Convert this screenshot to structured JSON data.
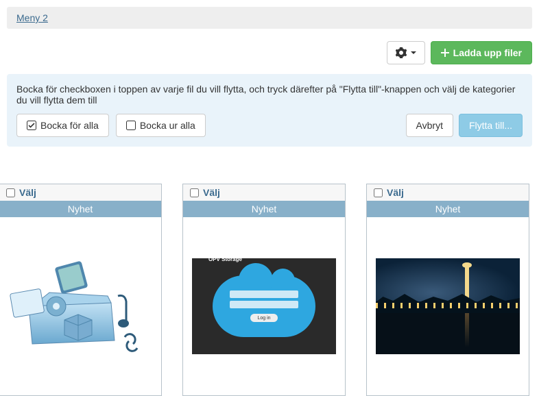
{
  "menu": {
    "label": "Meny 2"
  },
  "toolbar": {
    "upload_label": "Ladda upp filer"
  },
  "info": {
    "text": "Bocka för checkboxen i toppen av varje fil du vill flytta, och tryck därefter på \"Flytta till\"-knappen och välj de kategorier du vill flytta dem till",
    "check_all": "Bocka för alla",
    "uncheck_all": "Bocka ur alla",
    "cancel": "Avbryt",
    "move_to": "Flytta till..."
  },
  "cards": [
    {
      "select": "Välj",
      "tag": "Nyhet"
    },
    {
      "select": "Välj",
      "tag": "Nyhet"
    },
    {
      "select": "Välj",
      "tag": "Nyhet"
    }
  ],
  "cloud": {
    "brand": "OPV Storage",
    "login": "Log in"
  }
}
